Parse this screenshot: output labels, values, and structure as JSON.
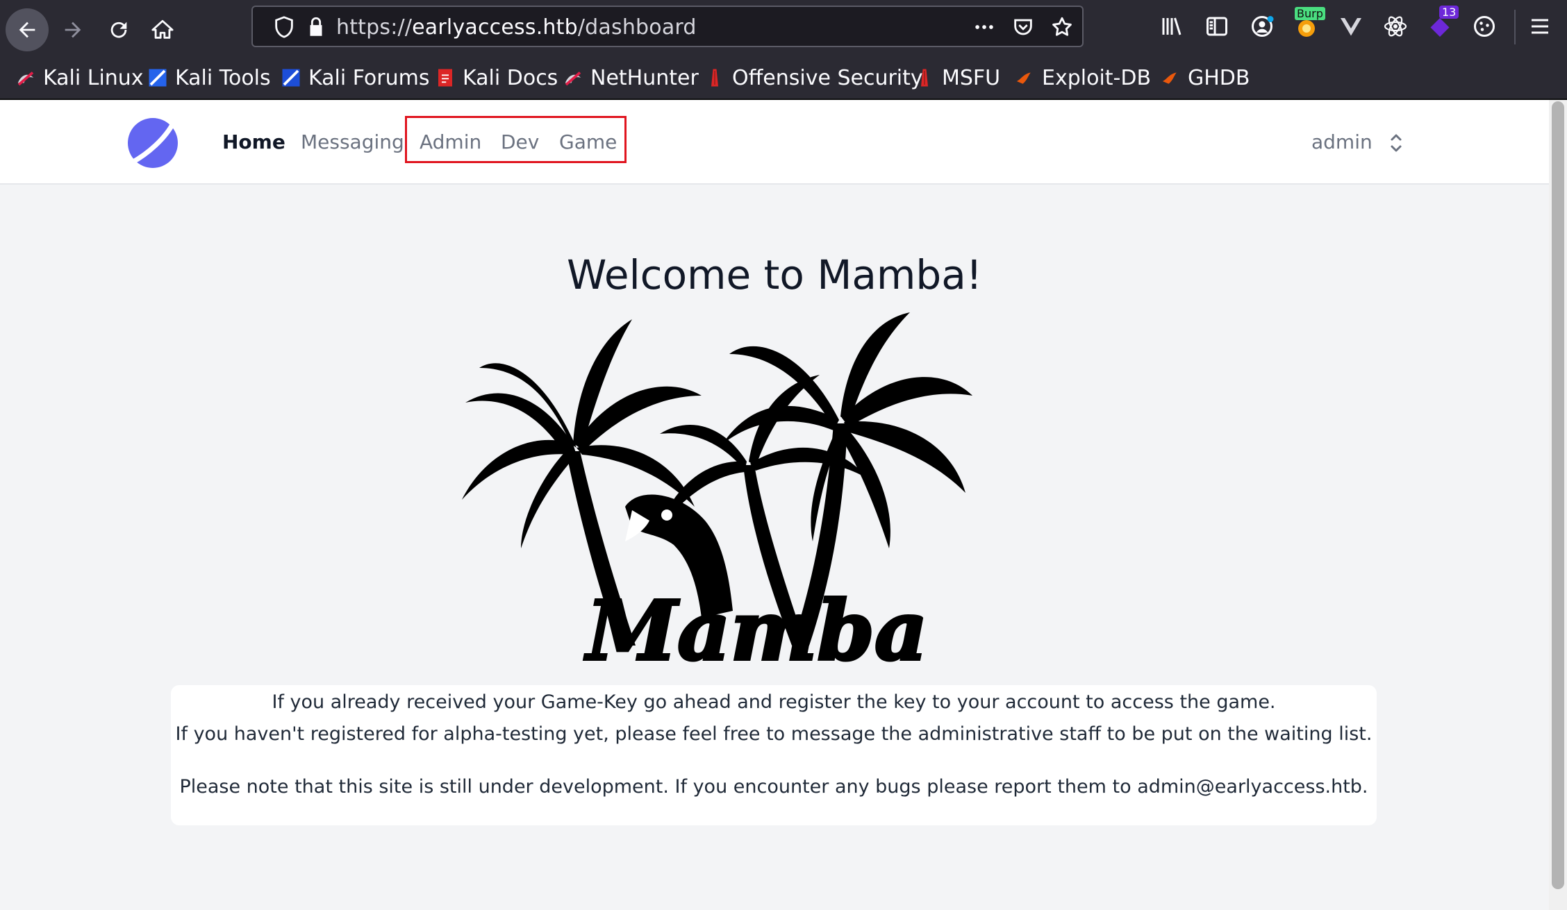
{
  "browser": {
    "url_scheme": "https://",
    "url_host": "earlyaccess.htb",
    "url_path": "/dashboard",
    "burp_badge": "Burp",
    "extension_badge_count": "13"
  },
  "bookmarks": [
    {
      "label": "Kali Linux",
      "icon": "kali-dragon-icon"
    },
    {
      "label": "Kali Tools",
      "icon": "kali-tools-icon"
    },
    {
      "label": "Kali Forums",
      "icon": "kali-forums-icon"
    },
    {
      "label": "Kali Docs",
      "icon": "kali-docs-icon"
    },
    {
      "label": "NetHunter",
      "icon": "nethunter-icon"
    },
    {
      "label": "Offensive Security",
      "icon": "offsec-icon"
    },
    {
      "label": "MSFU",
      "icon": "msfu-icon"
    },
    {
      "label": "Exploit-DB",
      "icon": "exploitdb-icon"
    },
    {
      "label": "GHDB",
      "icon": "ghdb-icon"
    }
  ],
  "nav": {
    "links": [
      "Home",
      "Messaging",
      "Admin",
      "Dev",
      "Game"
    ],
    "user": "admin"
  },
  "main": {
    "welcome": "Welcome to Mamba!",
    "logo_text": "Mamba",
    "line1": "If you already received your Game-Key go ahead and register the key to your account to access the game.",
    "line2": "If you haven't registered for alpha-testing yet, please feel free to message the administrative staff to be put on the waiting list.",
    "line3": "Please note that this site is still under development. If you encounter any bugs please report them to admin@earlyaccess.htb."
  },
  "colors": {
    "chrome_bg": "#2b2a33",
    "accent_logo": "#6366f1",
    "highlight_border": "#e0141e",
    "page_bg": "#f3f4f6"
  }
}
